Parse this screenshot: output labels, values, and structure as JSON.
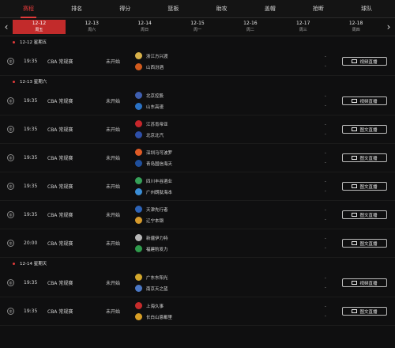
{
  "tabs": [
    "赛程",
    "排名",
    "得分",
    "篮板",
    "助攻",
    "盖帽",
    "抢断",
    "球队"
  ],
  "active_tab": 0,
  "date_nav": {
    "prev_icon": "chevron-left-icon",
    "next_icon": "chevron-right-icon",
    "dates": [
      {
        "date": "12-12",
        "weekday": "周五",
        "active": true
      },
      {
        "date": "12-13",
        "weekday": "周六",
        "active": false
      },
      {
        "date": "12-14",
        "weekday": "周日",
        "active": false
      },
      {
        "date": "12-15",
        "weekday": "周一",
        "active": false
      },
      {
        "date": "12-16",
        "weekday": "周二",
        "active": false
      },
      {
        "date": "12-17",
        "weekday": "周三",
        "active": false
      },
      {
        "date": "12-18",
        "weekday": "周四",
        "active": false
      }
    ]
  },
  "colors": {
    "accent": "#e23a3a",
    "active_date_bg": "#c22b2b",
    "background": "#0f0f10"
  },
  "sections": [
    {
      "label": "12-12 星期五",
      "games": [
        {
          "time": "19:35",
          "league": "CBA 常规赛",
          "status": "未开始",
          "team1": "浙江方兴渡",
          "team2": "山西汾酒",
          "team1_color": "#d8b14a",
          "team2_color": "#d15a1d",
          "score1": "-",
          "score2": "-",
          "button": "视频直播"
        }
      ]
    },
    {
      "label": "12-13 星期六",
      "games": [
        {
          "time": "19:35",
          "league": "CBA 常规赛",
          "status": "未开始",
          "team1": "北京控股",
          "team2": "山东高速",
          "team1_color": "#3f5fb0",
          "team2_color": "#2a72c5",
          "score1": "-",
          "score2": "-",
          "button": "视频直播"
        },
        {
          "time": "19:35",
          "league": "CBA 常规赛",
          "status": "未开始",
          "team1": "江苏肯帝亚",
          "team2": "北京北汽",
          "team1_color": "#c6262b",
          "team2_color": "#2e4fa8",
          "score1": "-",
          "score2": "-",
          "button": "图文直播"
        },
        {
          "time": "19:35",
          "league": "CBA 常规赛",
          "status": "未开始",
          "team1": "深圳马可波罗",
          "team2": "青岛国信海天",
          "team1_color": "#e05b26",
          "team2_color": "#1f4f9c",
          "score1": "-",
          "score2": "-",
          "button": "图文直播"
        },
        {
          "time": "19:35",
          "league": "CBA 常规赛",
          "status": "未开始",
          "team1": "四川丰谷酒业",
          "team2": "广州朗肽海本",
          "team1_color": "#36a058",
          "team2_color": "#3b8ed6",
          "score1": "-",
          "score2": "-",
          "button": "图文直播"
        },
        {
          "time": "19:35",
          "league": "CBA 常规赛",
          "status": "未开始",
          "team1": "天津先行者",
          "team2": "辽宁本钢",
          "team1_color": "#2d63b7",
          "team2_color": "#d69a2c",
          "score1": "-",
          "score2": "-",
          "button": "图文直播"
        },
        {
          "time": "20:00",
          "league": "CBA 常规赛",
          "status": "未开始",
          "team1": "新疆伊力特",
          "team2": "福建豹发力",
          "team1_color": "#b8b8b8",
          "team2_color": "#2f9b4c",
          "score1": "-",
          "score2": "-",
          "button": "图文直播"
        }
      ]
    },
    {
      "label": "12-14 星期天",
      "games": [
        {
          "time": "19:35",
          "league": "CBA 常规赛",
          "status": "未开始",
          "team1": "广东东阳光",
          "team2": "南京天之蓝",
          "team1_color": "#d3a72c",
          "team2_color": "#4b78c5",
          "score1": "-",
          "score2": "-",
          "button": "视频直播"
        },
        {
          "time": "19:35",
          "league": "CBA 常规赛",
          "status": "未开始",
          "team1": "上海久事",
          "team2": "长白山恩都里",
          "team1_color": "#c62b2b",
          "team2_color": "#d79e25",
          "score1": "-",
          "score2": "-",
          "button": "图文直播"
        }
      ]
    }
  ]
}
